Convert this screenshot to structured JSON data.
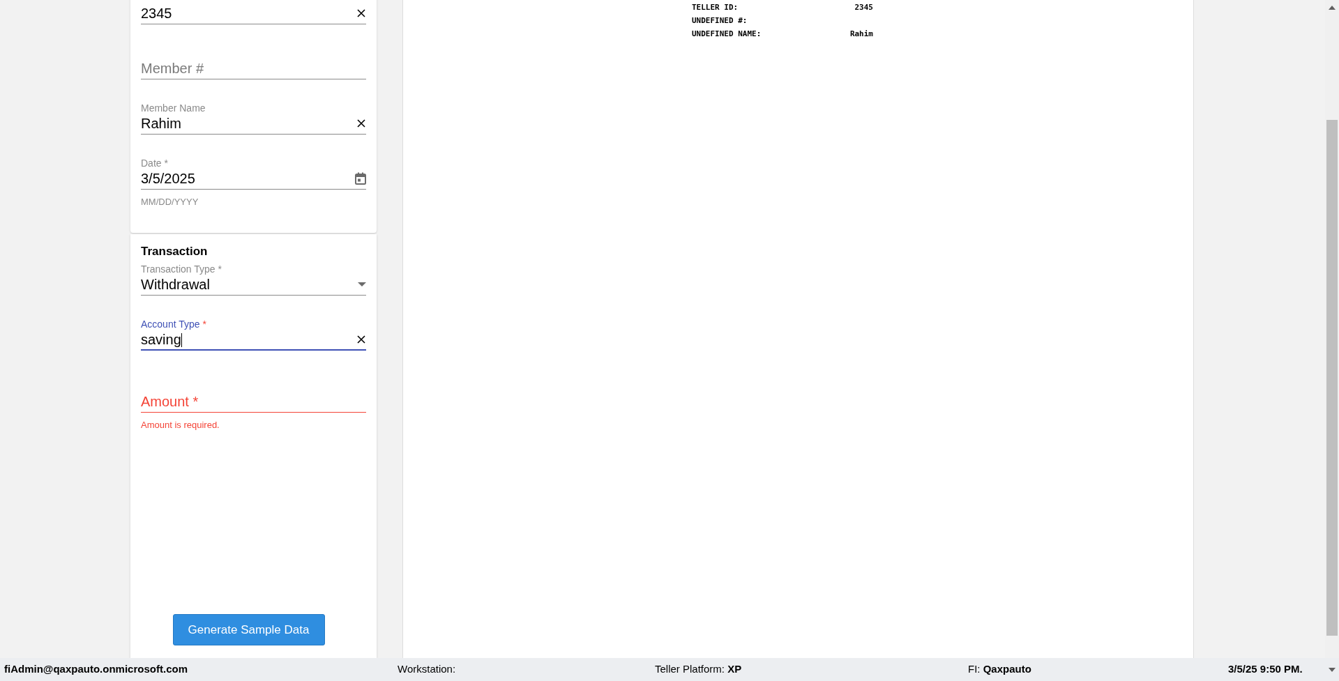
{
  "form_card": {
    "fields": [
      {
        "kind": "text",
        "value": "2345",
        "clearable": true
      },
      {
        "kind": "text",
        "placeholder": "Member #"
      },
      {
        "kind": "text",
        "label": "Member Name",
        "value": "Rahim",
        "clearable": true
      },
      {
        "kind": "date",
        "label": "Date *",
        "value": "3/5/2025",
        "helper": "MM/DD/YYYY"
      }
    ]
  },
  "transaction_card": {
    "title": "Transaction",
    "fields": [
      {
        "kind": "select",
        "label": "Transaction Type *",
        "value": "Withdrawal"
      },
      {
        "kind": "text",
        "label": "Account Type",
        "required_mark": "*",
        "value": "saving",
        "clearable": true,
        "focused": true
      },
      {
        "kind": "text",
        "placeholder": "Amount *",
        "error": "Amount is required."
      }
    ],
    "button": "Generate Sample Data"
  },
  "receipt": {
    "lines": [
      {
        "label": "TELLER ID:",
        "value": "2345"
      },
      {
        "label": "UNDEFINED #:"
      },
      {
        "label": "UNDEFINED NAME:",
        "value": "Rahim"
      }
    ]
  },
  "status_bar": {
    "user": "fiAdmin@qaxpauto.onmicrosoft.com",
    "workstation_label": "Workstation:",
    "platform_label": "Teller Platform:",
    "platform": "XP",
    "fi_label": "FI:",
    "fi": "Qaxpauto",
    "datetime": "3/5/25 9:50 PM."
  }
}
